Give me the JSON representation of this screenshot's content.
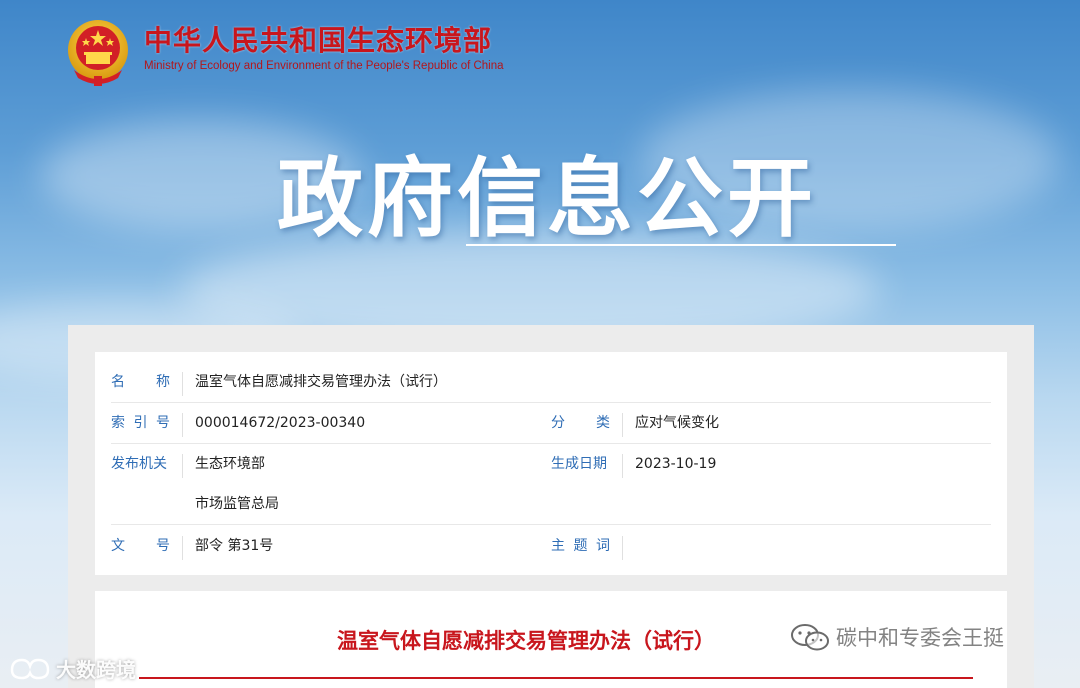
{
  "header": {
    "org_name_cn": "中华人民共和国生态环境部",
    "org_name_en": "Ministry of Ecology and Environment of the People's Republic of China",
    "banner_title": "政府信息公开"
  },
  "info": {
    "name_label": "名　称",
    "name_value": "温室气体自愿减排交易管理办法（试行）",
    "index_label": "索引号",
    "index_value": "000014672/2023-00340",
    "category_label": "分　类",
    "category_value": "应对气候变化",
    "issuer_label": "发布机关",
    "issuer_values": [
      "生态环境部",
      "市场监管总局"
    ],
    "date_label": "生成日期",
    "date_value": "2023-10-19",
    "docno_label": "文　号",
    "docno_value": "部令 第31号",
    "topic_label": "主题词",
    "topic_value": ""
  },
  "document": {
    "title": "温室气体自愿减排交易管理办法（试行）"
  },
  "watermarks": {
    "left_text": "大数跨境",
    "right_text": "碳中和专委会王挺"
  },
  "colors": {
    "brand_red": "#c8161d",
    "label_blue": "#2f6db5"
  },
  "icons": {
    "emblem": "national-emblem-icon",
    "left_wm": "weibo-logo-icon",
    "right_wm": "wechat-icon"
  }
}
